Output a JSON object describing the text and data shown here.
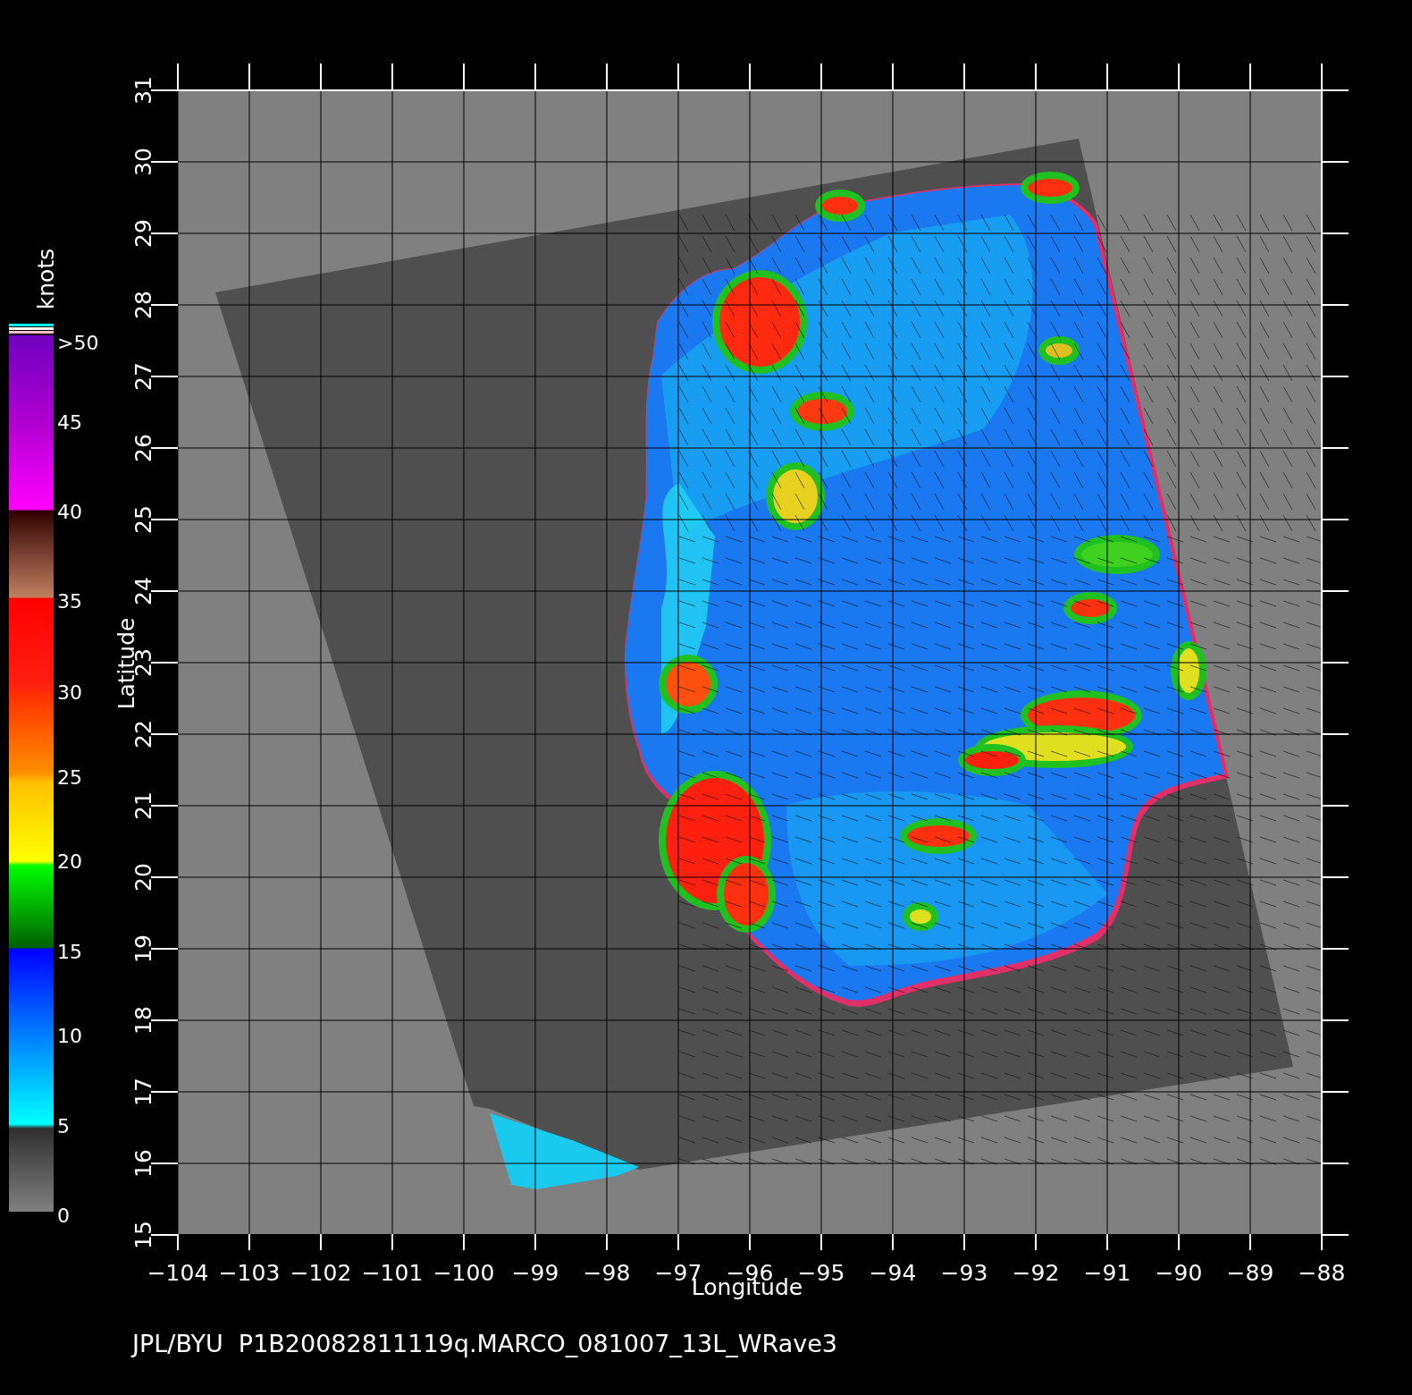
{
  "map": {
    "x_axis": {
      "title": "Longitude",
      "tick_labels": [
        "−104",
        "−103",
        "−102",
        "−101",
        "−100",
        "−99",
        "−98",
        "−97",
        "−96",
        "−95",
        "−94",
        "−93",
        "−92",
        "−91",
        "−90",
        "−89",
        "−88"
      ]
    },
    "y_axis": {
      "title": "Latitude",
      "tick_labels": [
        "31",
        "30",
        "29",
        "28",
        "27",
        "26",
        "25",
        "24",
        "23",
        "22",
        "21",
        "20",
        "19",
        "18",
        "17",
        "16",
        "15"
      ]
    }
  },
  "colorbar": {
    "title": "knots",
    "labels": [
      ">50",
      "45",
      "40",
      "35",
      "30",
      "25",
      "20",
      "15",
      "10",
      "5",
      "0"
    ]
  },
  "caption": "JPL/BYU  P1B20082811119q.MARCO_081007_13L_WRave3"
}
